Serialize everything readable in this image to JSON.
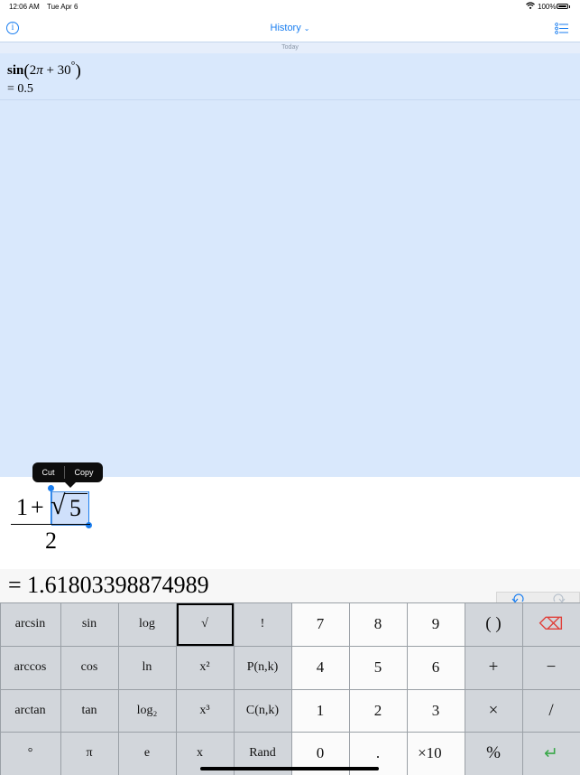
{
  "status": {
    "time": "12:06 AM",
    "date": "Tue Apr 6",
    "battery": "100%"
  },
  "nav": {
    "info": "i",
    "title": "History",
    "chevron": "⌄",
    "list_icon": "list-settings-icon"
  },
  "history": {
    "section": "Today",
    "entries": [
      {
        "fn": "sin",
        "open": "(",
        "arg_a": "2",
        "pi": "π",
        "plus": " + ",
        "arg_b": "30",
        "deg": "°",
        "close": ")",
        "result": "= 0.5"
      }
    ]
  },
  "editor": {
    "numerator_left": "1",
    "plus": "+",
    "radical": "√",
    "radicand": "5",
    "denominator": "2",
    "popup": {
      "cut": "Cut",
      "copy": "Copy"
    }
  },
  "result": "= 1.61803398874989",
  "keypad": {
    "rows": [
      [
        {
          "label": "arcsin",
          "style": "gray"
        },
        {
          "label": "sin",
          "style": "gray"
        },
        {
          "label": "log",
          "style": "gray"
        },
        {
          "label": "√",
          "style": "sel"
        },
        {
          "label": "!",
          "style": "gray"
        },
        {
          "label": "7",
          "style": "white"
        },
        {
          "label": "8",
          "style": "white"
        },
        {
          "label": "9",
          "style": "white"
        },
        {
          "label": "( )",
          "style": "op"
        },
        {
          "label": "⌫",
          "style": "op",
          "icon": "backspace-icon",
          "color": "#e0403a"
        }
      ],
      [
        {
          "label": "arccos",
          "style": "gray"
        },
        {
          "label": "cos",
          "style": "gray"
        },
        {
          "label": "ln",
          "style": "gray"
        },
        {
          "label": "x²",
          "style": "gray"
        },
        {
          "label": "P(n,k)",
          "style": "gray"
        },
        {
          "label": "4",
          "style": "white"
        },
        {
          "label": "5",
          "style": "white"
        },
        {
          "label": "6",
          "style": "white"
        },
        {
          "label": "+",
          "style": "op"
        },
        {
          "label": "−",
          "style": "op"
        }
      ],
      [
        {
          "label": "arctan",
          "style": "gray"
        },
        {
          "label": "tan",
          "style": "gray"
        },
        {
          "label": "log₂",
          "style": "gray"
        },
        {
          "label": "x³",
          "style": "gray"
        },
        {
          "label": "C(n,k)",
          "style": "gray"
        },
        {
          "label": "1",
          "style": "white"
        },
        {
          "label": "2",
          "style": "white"
        },
        {
          "label": "3",
          "style": "white"
        },
        {
          "label": "×",
          "style": "op"
        },
        {
          "label": "/",
          "style": "op"
        }
      ],
      [
        {
          "label": "°",
          "style": "gray"
        },
        {
          "label": "π",
          "style": "gray"
        },
        {
          "label": "e",
          "style": "gray"
        },
        {
          "label": "x⃞",
          "style": "gray"
        },
        {
          "label": "Rand",
          "style": "gray"
        },
        {
          "label": "0",
          "style": "white"
        },
        {
          "label": ".",
          "style": "white"
        },
        {
          "label": "×10⃞",
          "style": "white"
        },
        {
          "label": "%",
          "style": "op"
        },
        {
          "label": "↵",
          "style": "op",
          "icon": "return-icon",
          "color": "#3aa84a"
        }
      ]
    ]
  },
  "colors": {
    "accent": "#1a7ef0",
    "history_bg": "#d9e8fc"
  }
}
